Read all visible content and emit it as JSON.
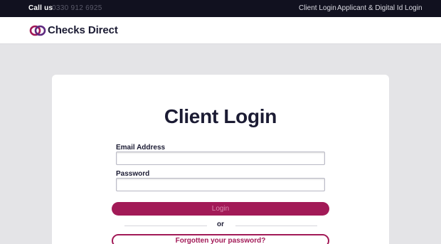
{
  "topbar": {
    "call_label": "Call us",
    "phone": "0330 912 6925",
    "links": {
      "client_login": "Client Login",
      "applicant_login": "Applicant & Digital Id Login"
    }
  },
  "header": {
    "logo_icon": "linked-rings-icon",
    "brand_name": "Checks Direct"
  },
  "login_card": {
    "title": "Client Login",
    "email_label": "Email Address",
    "email_value": "",
    "password_label": "Password",
    "password_value": "",
    "login_button": "Login",
    "or_text": "or",
    "forgot_button": "Forgotten your password?"
  },
  "colors": {
    "topbar_bg": "#11111f",
    "brand_accent": "#a21a57",
    "text_dark": "#1b1b33",
    "page_bg": "#e4e4e7"
  }
}
